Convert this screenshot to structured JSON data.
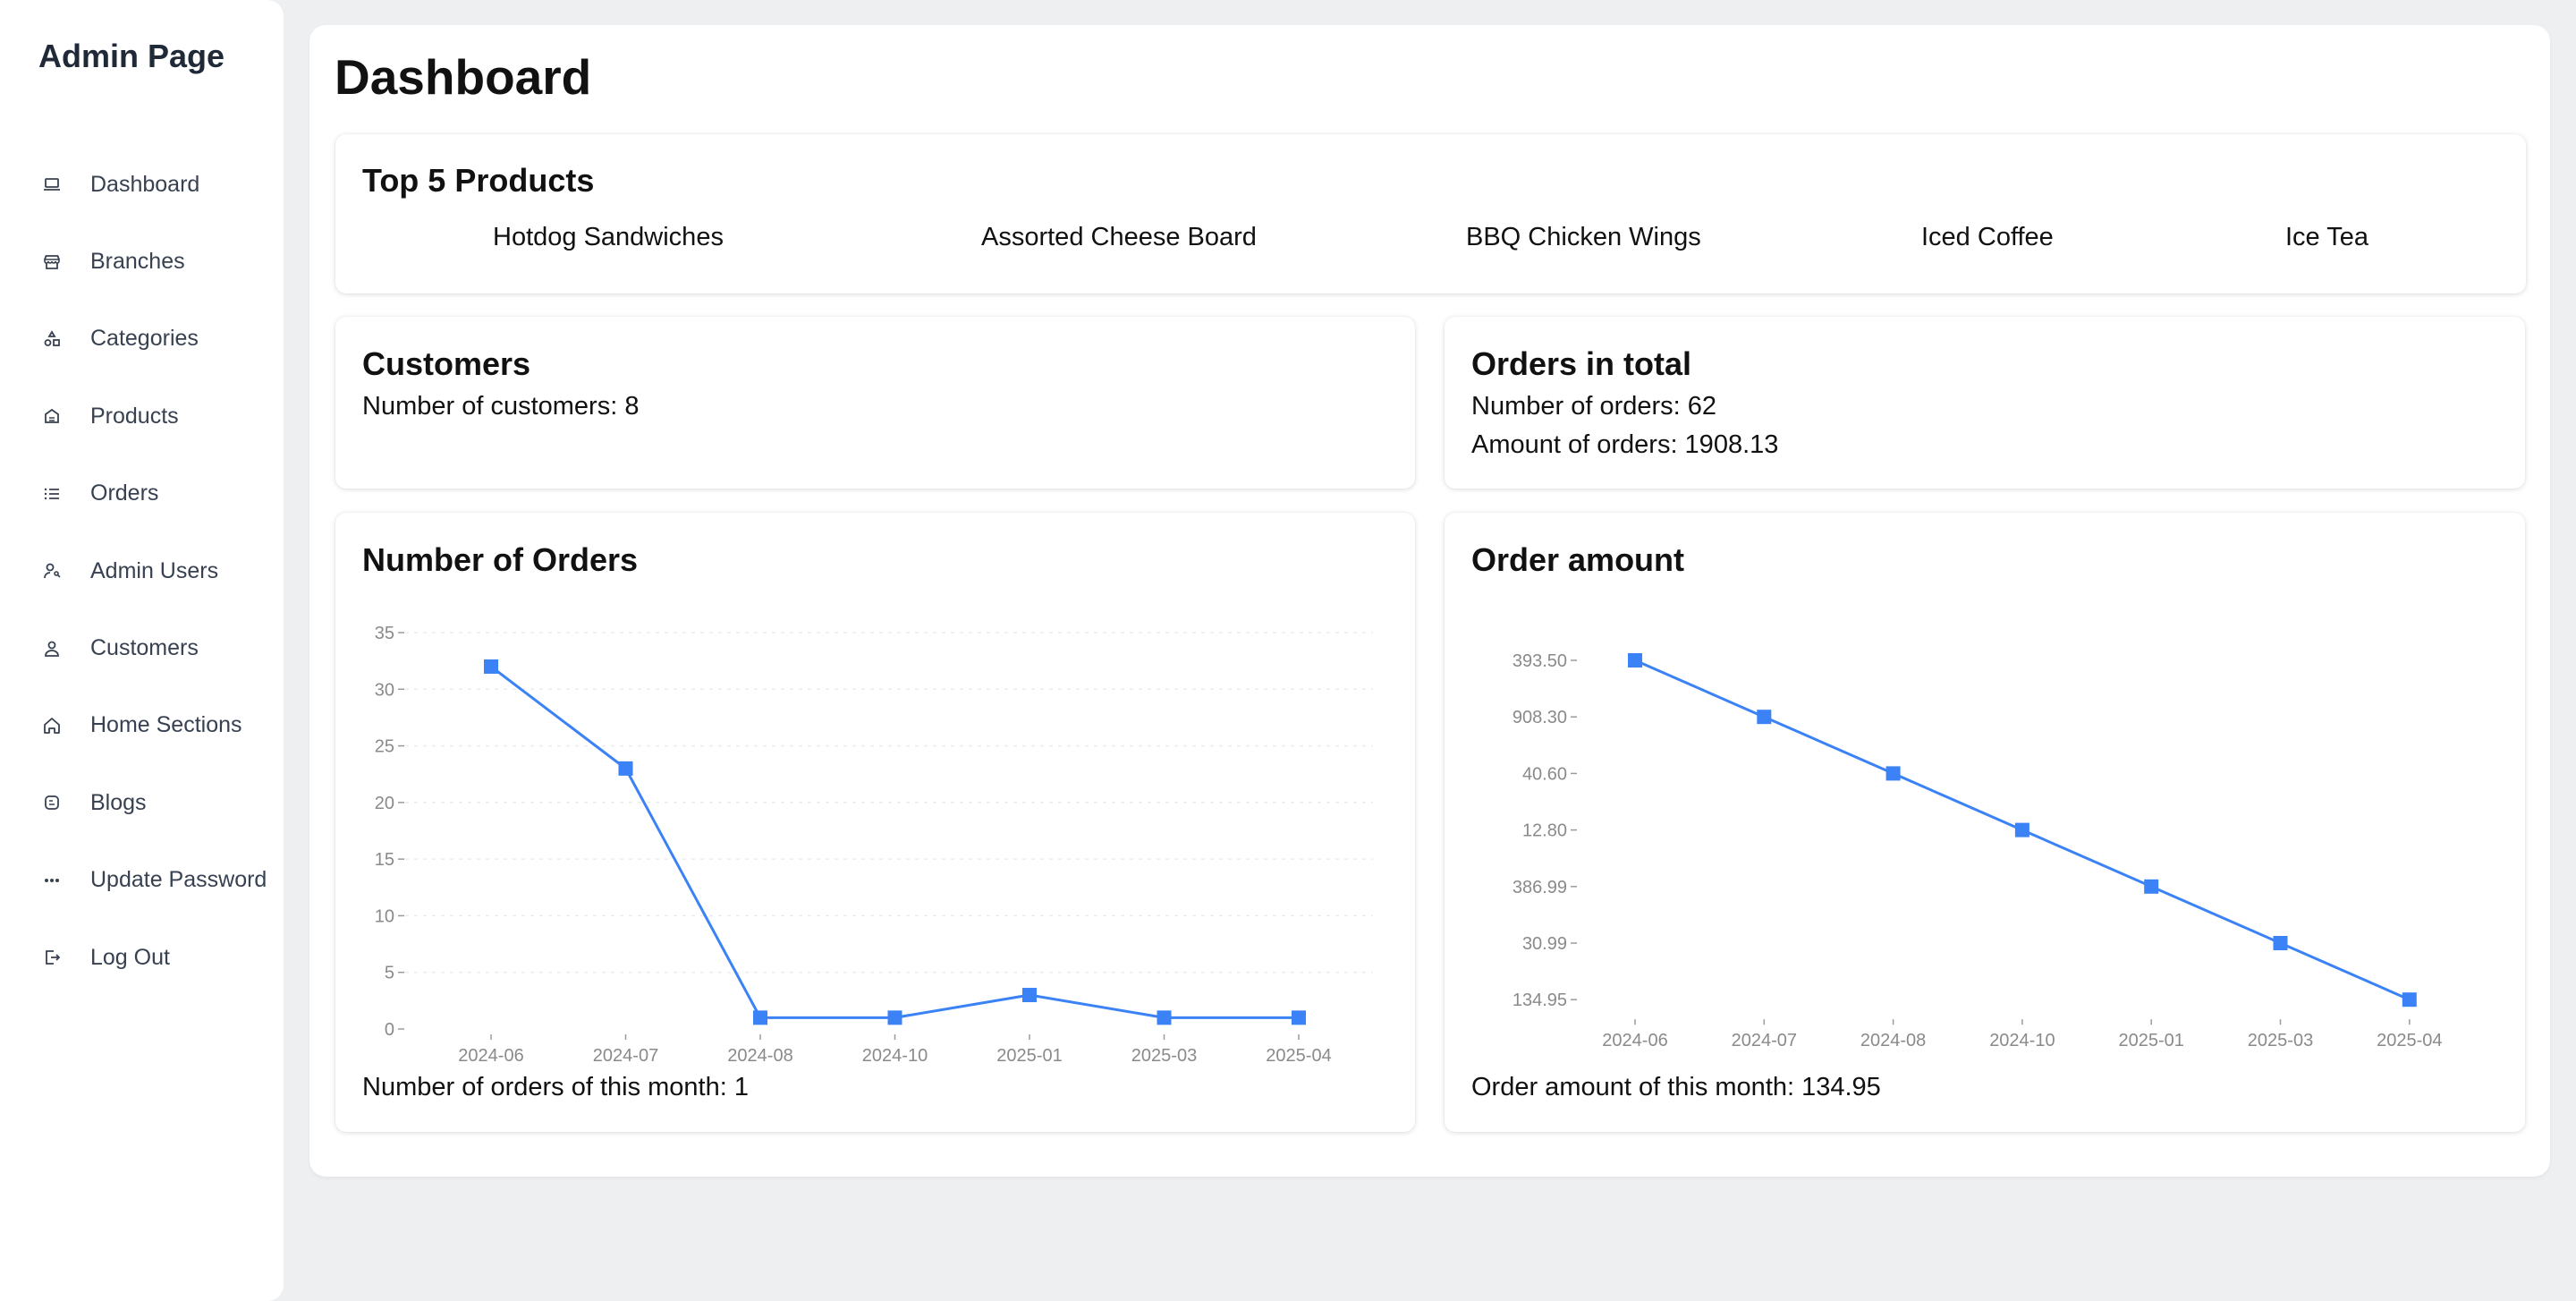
{
  "sidebar": {
    "brand": "Admin Page",
    "items": [
      {
        "label": "Dashboard",
        "icon": "laptop-icon"
      },
      {
        "label": "Branches",
        "icon": "store-icon"
      },
      {
        "label": "Categories",
        "icon": "shapes-icon"
      },
      {
        "label": "Products",
        "icon": "food-icon"
      },
      {
        "label": "Orders",
        "icon": "list-icon"
      },
      {
        "label": "Admin Users",
        "icon": "user-key-icon"
      },
      {
        "label": "Customers",
        "icon": "user-icon"
      },
      {
        "label": "Home Sections",
        "icon": "home-icon"
      },
      {
        "label": "Blogs",
        "icon": "blog-icon"
      },
      {
        "label": "Update Password",
        "icon": "password-dots-icon"
      },
      {
        "label": "Log Out",
        "icon": "logout-icon"
      }
    ]
  },
  "page": {
    "title": "Dashboard"
  },
  "top_products": {
    "title": "Top 5 Products",
    "items": [
      "Hotdog Sandwiches",
      "Assorted Cheese Board",
      "BBQ Chicken Wings",
      "Iced Coffee",
      "Ice Tea"
    ]
  },
  "customers": {
    "title": "Customers",
    "count_text": "Number of customers: 8"
  },
  "orders_total": {
    "title": "Orders in total",
    "count_text": "Number of orders: 62",
    "amount_text": "Amount of orders: 1908.13"
  },
  "orders_chart": {
    "title": "Number of Orders",
    "footer": "Number of orders of this month: 1"
  },
  "amount_chart": {
    "title": "Order amount",
    "footer": "Order amount of this month: 134.95"
  },
  "colors": {
    "series": "#3b82f6",
    "accent": "#3b82f6"
  },
  "chart_data": [
    {
      "type": "line",
      "title": "Number of Orders",
      "categories": [
        "2024-06",
        "2024-07",
        "2024-08",
        "2024-10",
        "2025-01",
        "2025-03",
        "2025-04"
      ],
      "values": [
        32,
        23,
        1,
        1,
        3,
        1,
        1
      ],
      "ylim": [
        0,
        35
      ],
      "yticks": [
        0,
        5,
        10,
        15,
        20,
        25,
        30,
        35
      ],
      "grid": true
    },
    {
      "type": "line",
      "title": "Order amount",
      "categories": [
        "2024-06",
        "2024-07",
        "2024-08",
        "2024-10",
        "2025-01",
        "2025-03",
        "2025-04"
      ],
      "values": [
        "393.50",
        "908.30",
        "40.60",
        "12.80",
        "386.99",
        "30.99",
        "134.95"
      ],
      "yticks": [
        "393.50",
        "908.30",
        "40.60",
        "12.80",
        "386.99",
        "30.99",
        "134.95"
      ],
      "y_axis": "categorical",
      "grid": false
    }
  ]
}
